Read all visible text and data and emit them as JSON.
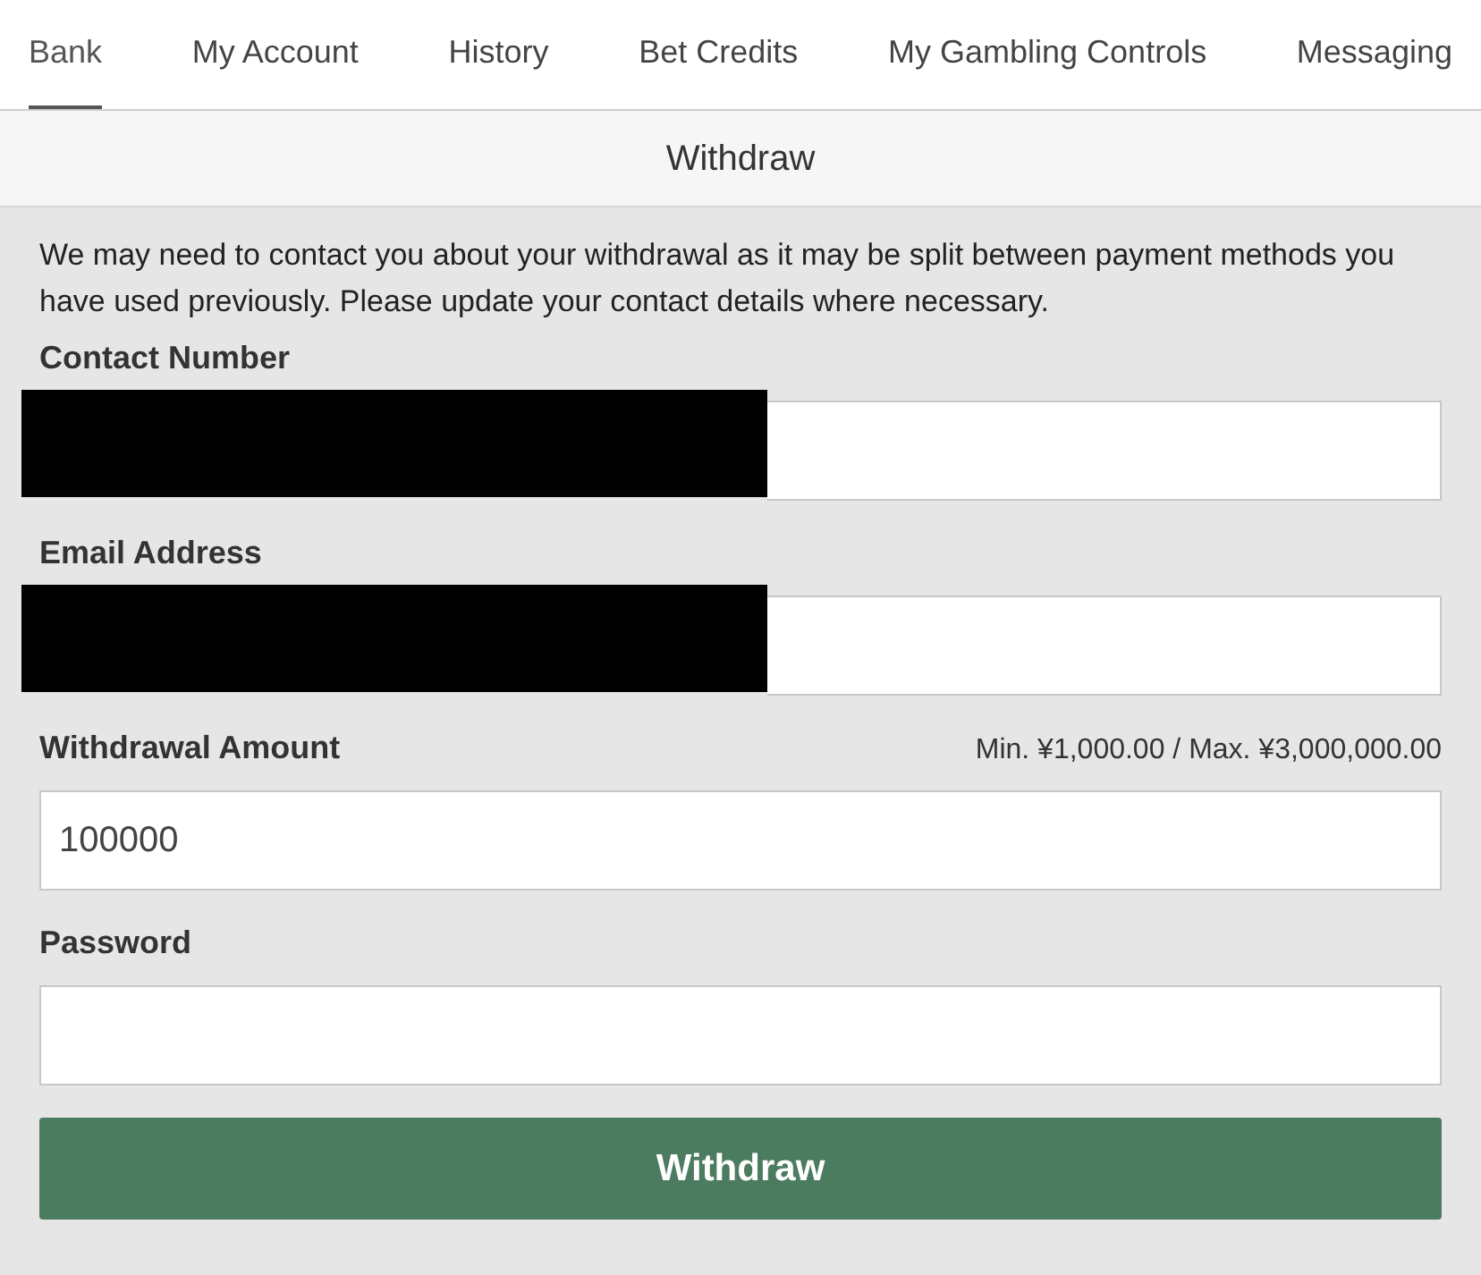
{
  "tabs": [
    {
      "label": "Bank",
      "selected": true
    },
    {
      "label": "My Account",
      "selected": false
    },
    {
      "label": "History",
      "selected": false
    },
    {
      "label": "Bet Credits",
      "selected": false
    },
    {
      "label": "My Gambling Controls",
      "selected": false
    },
    {
      "label": "Messaging",
      "selected": false
    }
  ],
  "header": {
    "title": "Withdraw"
  },
  "notice": "We may need to contact you about your withdrawal as it may be split between payment methods you have used previously. Please update your contact details where necessary.",
  "fields": [
    {
      "label": "Contact Number",
      "redacted": true
    },
    {
      "label": "Email Address",
      "redacted": true
    },
    {
      "label": "Withdrawal Amount",
      "hint": "Min. ¥1,000.00 / Max. ¥3,000,000.00",
      "value": "100000",
      "redacted": false
    },
    {
      "label": "Password",
      "redacted": false
    }
  ],
  "button": "Withdraw"
}
